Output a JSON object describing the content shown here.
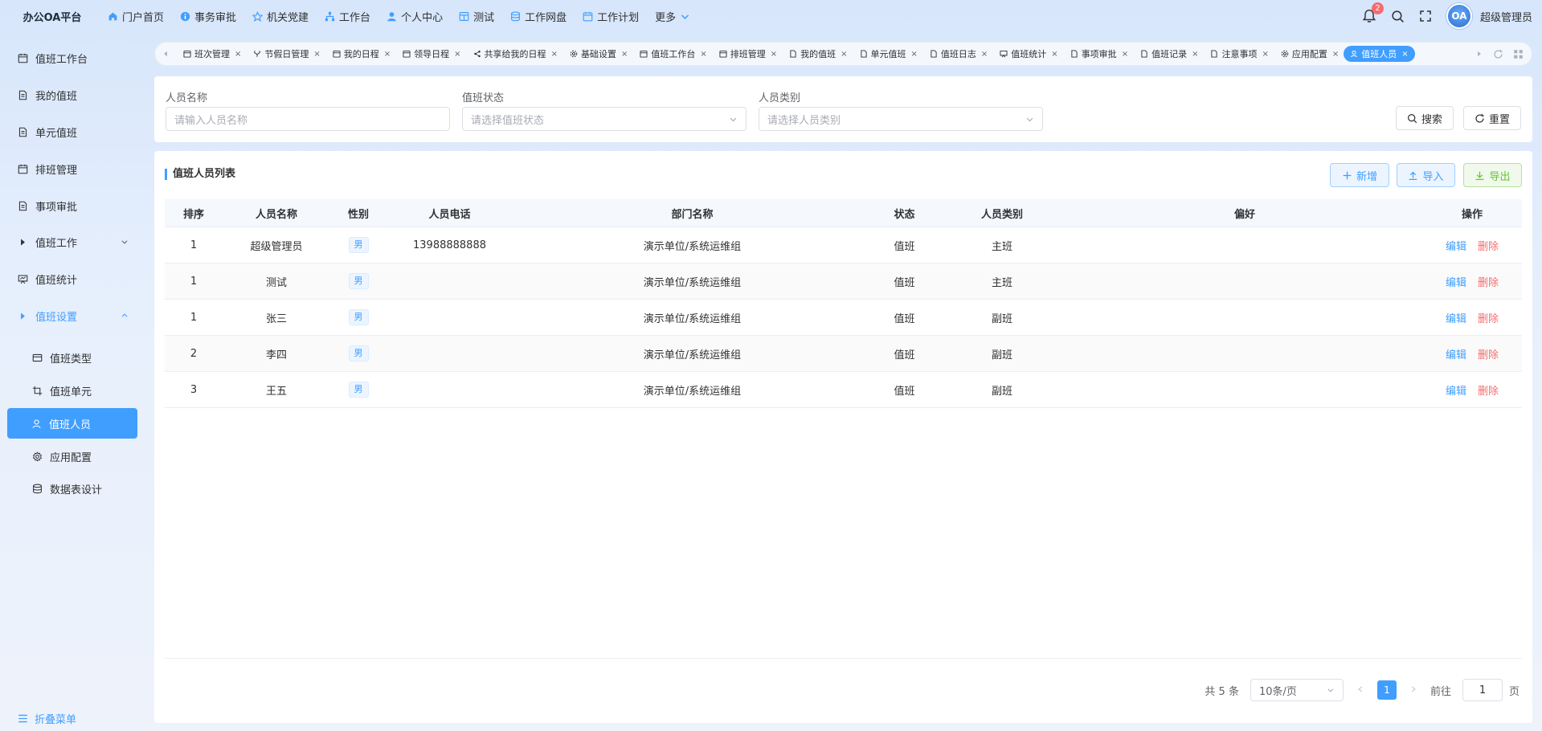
{
  "brand": "办公OA平台",
  "topnav": [
    {
      "label": "门户首页",
      "icon": "home-icon"
    },
    {
      "label": "事务审批",
      "icon": "info-icon"
    },
    {
      "label": "机关党建",
      "icon": "star-icon"
    },
    {
      "label": "工作台",
      "icon": "org-icon"
    },
    {
      "label": "个人中心",
      "icon": "user-icon"
    },
    {
      "label": "测试",
      "icon": "grid-icon"
    },
    {
      "label": "工作网盘",
      "icon": "database-icon"
    },
    {
      "label": "工作计划",
      "icon": "calendar-icon"
    },
    {
      "label": "更多",
      "icon": "chevron-down-icon"
    }
  ],
  "header": {
    "notification_count": "2",
    "avatar_text": "OA",
    "username": "超级管理员"
  },
  "sidebar": {
    "items": [
      {
        "label": "值班工作台"
      },
      {
        "label": "我的值班"
      },
      {
        "label": "单元值班"
      },
      {
        "label": "排班管理"
      },
      {
        "label": "事项审批"
      },
      {
        "label": "值班工作"
      },
      {
        "label": "值班统计"
      },
      {
        "label": "值班设置"
      }
    ],
    "sub_items": [
      {
        "label": "值班类型"
      },
      {
        "label": "值班单元"
      },
      {
        "label": "值班人员"
      },
      {
        "label": "应用配置"
      },
      {
        "label": "数据表设计"
      }
    ],
    "collapse_label": "折叠菜单"
  },
  "tabs": [
    {
      "label": "班次管理"
    },
    {
      "label": "节假日管理"
    },
    {
      "label": "我的日程"
    },
    {
      "label": "领导日程"
    },
    {
      "label": "共享给我的日程"
    },
    {
      "label": "基础设置"
    },
    {
      "label": "值班工作台"
    },
    {
      "label": "排班管理"
    },
    {
      "label": "我的值班"
    },
    {
      "label": "单元值班"
    },
    {
      "label": "值班日志"
    },
    {
      "label": "值班统计"
    },
    {
      "label": "事项审批"
    },
    {
      "label": "值班记录"
    },
    {
      "label": "注意事项"
    },
    {
      "label": "应用配置"
    },
    {
      "label": "值班人员"
    }
  ],
  "filter": {
    "name_label": "人员名称",
    "name_placeholder": "请输入人员名称",
    "status_label": "值班状态",
    "status_placeholder": "请选择值班状态",
    "type_label": "人员类别",
    "type_placeholder": "请选择人员类别",
    "search_label": "搜索",
    "reset_label": "重置"
  },
  "list": {
    "title": "值班人员列表",
    "add_label": "新增",
    "import_label": "导入",
    "export_label": "导出",
    "columns": [
      "排序",
      "人员名称",
      "性别",
      "人员电话",
      "部门名称",
      "状态",
      "人员类别",
      "偏好",
      "操作"
    ],
    "rows": [
      {
        "order": "1",
        "name": "超级管理员",
        "sex": "男",
        "phone": "13988888888",
        "dept": "演示单位/系统运维组",
        "state": "值班",
        "type": "主班",
        "pref": "",
        "edit": "编辑",
        "del": "删除"
      },
      {
        "order": "1",
        "name": "测试",
        "sex": "男",
        "phone": "",
        "dept": "演示单位/系统运维组",
        "state": "值班",
        "type": "主班",
        "pref": "",
        "edit": "编辑",
        "del": "删除"
      },
      {
        "order": "1",
        "name": "张三",
        "sex": "男",
        "phone": "",
        "dept": "演示单位/系统运维组",
        "state": "值班",
        "type": "副班",
        "pref": "",
        "edit": "编辑",
        "del": "删除"
      },
      {
        "order": "2",
        "name": "李四",
        "sex": "男",
        "phone": "",
        "dept": "演示单位/系统运维组",
        "state": "值班",
        "type": "副班",
        "pref": "",
        "edit": "编辑",
        "del": "删除"
      },
      {
        "order": "3",
        "name": "王五",
        "sex": "男",
        "phone": "",
        "dept": "演示单位/系统运维组",
        "state": "值班",
        "type": "副班",
        "pref": "",
        "edit": "编辑",
        "del": "删除"
      }
    ]
  },
  "pagination": {
    "total": "共 5 条",
    "page_size": "10条/页",
    "current": "1",
    "goto_label": "前往",
    "goto_value": "1",
    "page_unit": "页"
  },
  "colors": {
    "primary": "#409eff",
    "danger": "#f56c6c",
    "success": "#67c23a"
  }
}
